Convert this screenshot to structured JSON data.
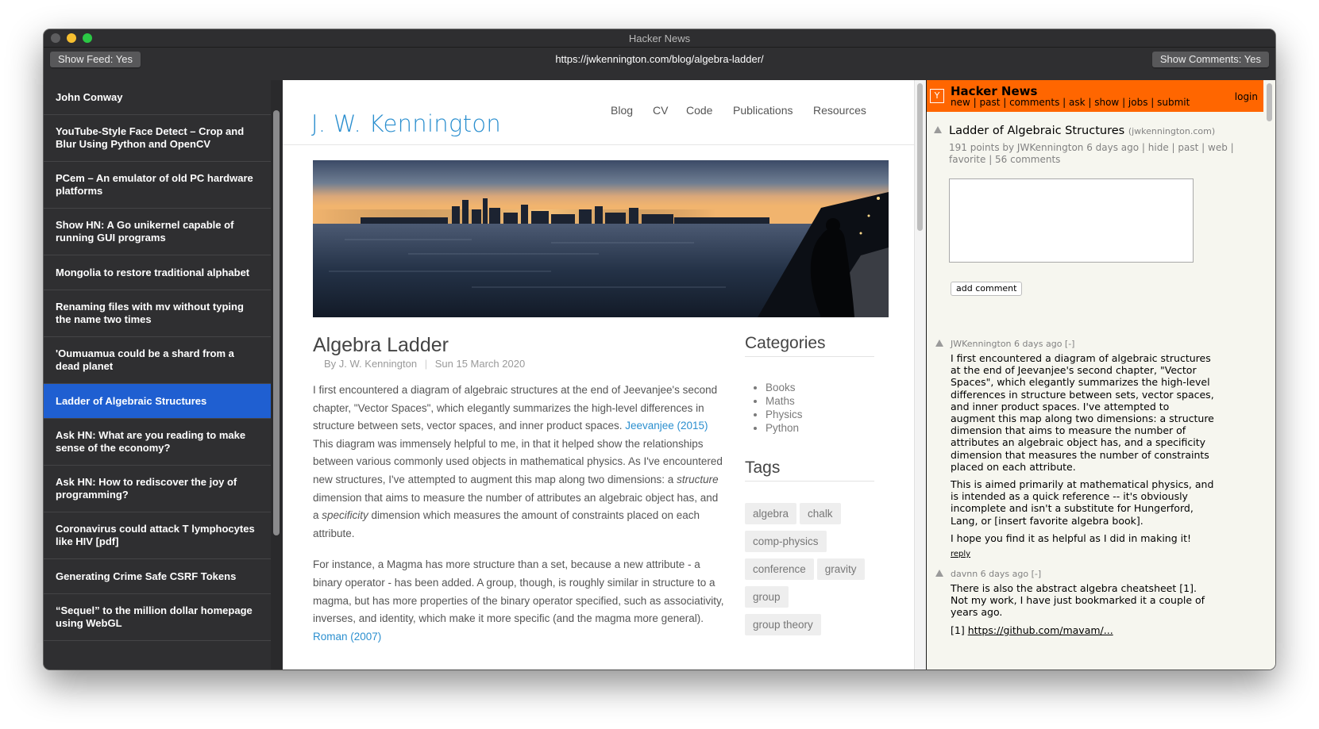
{
  "window": {
    "title": "Hacker News"
  },
  "toolbar": {
    "show_feed": "Show Feed: Yes",
    "url": "https://jwkennington.com/blog/algebra-ladder/",
    "show_comments": "Show Comments: Yes"
  },
  "sidebar": {
    "items": [
      {
        "label": "John Conway"
      },
      {
        "label": "YouTube-Style Face Detect – Crop and Blur Using Python and OpenCV"
      },
      {
        "label": "PCem – An emulator of old PC hardware platforms"
      },
      {
        "label": "Show HN: A Go unikernel capable of running GUI programs"
      },
      {
        "label": "Mongolia to restore traditional alphabet"
      },
      {
        "label": "Renaming files with mv without typing the name two times"
      },
      {
        "label": "'Oumuamua could be a shard from a dead planet"
      },
      {
        "label": "Ladder of Algebraic Structures"
      },
      {
        "label": "Ask HN: What are you reading to make sense of the economy?"
      },
      {
        "label": "Ask HN: How to rediscover the joy of programming?"
      },
      {
        "label": "Coronavirus could attack T lymphocytes like HIV [pdf]"
      },
      {
        "label": "Generating Crime Safe CSRF Tokens"
      },
      {
        "label": "“Sequel” to the million dollar homepage using WebGL"
      }
    ],
    "active_index": 7
  },
  "page": {
    "brand": "J. W. Kennington",
    "nav": [
      "Blog",
      "CV",
      "Code",
      "Publications",
      "Resources"
    ],
    "post": {
      "title": "Algebra Ladder",
      "author": "By J. W. Kennington",
      "date": "Sun 15 March 2020",
      "p1_a": "I first encountered a diagram of algebraic structures at the end of Jeevanjee's second chapter, \"Vector Spaces\", which elegantly summarizes the high-level differences in structure between sets, vector spaces, and inner product spaces. ",
      "p1_link": "Jeevanjee (2015)",
      "p1_b": " This diagram was immensely helpful to me, in that it helped show the relationships between various commonly used objects in mathematical physics. As I've encountered new structures, I've attempted to augment this map along two dimensions: a ",
      "p1_em1": "structure",
      "p1_c": " dimension that aims to measure the number of attributes an algebraic object has, and a ",
      "p1_em2": "specificity",
      "p1_d": " dimension which measures the amount of constraints placed on each attribute.",
      "p2_a": "For instance, a Magma has more structure than a set, because a new attribute - a binary operator - has been added. A group, though, is roughly similar in structure to a magma, but has more properties of the binary operator specified, such as associativity, inverses, and identity, which make it more specific (and the magma more general). ",
      "p2_link": "Roman (2007)"
    },
    "categories_title": "Categories",
    "categories": [
      "Books",
      "Maths",
      "Physics",
      "Python"
    ],
    "tags_title": "Tags",
    "tags": [
      "algebra",
      "chalk",
      "comp-physics",
      "conference",
      "gravity",
      "group",
      "group theory"
    ]
  },
  "hn": {
    "logo": "Y",
    "title": "Hacker News",
    "nav": "new | past | comments | ask | show | jobs | submit",
    "login": "login",
    "story": {
      "title": "Ladder of Algebraic Structures",
      "domain": "(jwkennington.com)",
      "subtext": "191 points by JWKennington 6 days ago | hide | past | web | favorite | 56 comments"
    },
    "add_comment": "add comment",
    "comments": [
      {
        "head": "JWKennington 6 days ago [-]",
        "paragraphs": [
          "I first encountered a diagram of algebraic structures at the end of Jeevanjee's second chapter, \"Vector Spaces\", which elegantly summarizes the high-level differences in structure between sets, vector spaces, and inner product spaces. I've attempted to augment this map along two dimensions: a structure dimension that aims to measure the number of attributes an algebraic object has, and a specificity dimension that measures the number of constraints placed on each attribute.",
          "This is aimed primarily at mathematical physics, and is intended as a quick reference -- it's obviously incomplete and isn't a substitute for Hungerford, Lang, or [insert favorite algebra book].",
          "I hope you find it as helpful as I did in making it!"
        ],
        "reply": "reply"
      },
      {
        "head": "davnn 6 days ago [-]",
        "paragraphs": [
          "There is also the abstract algebra cheatsheet [1]. Not my work, I have just bookmarked it a couple of years ago."
        ],
        "link_prefix": "[1] ",
        "link": "https://github.com/mavam/..."
      }
    ]
  }
}
